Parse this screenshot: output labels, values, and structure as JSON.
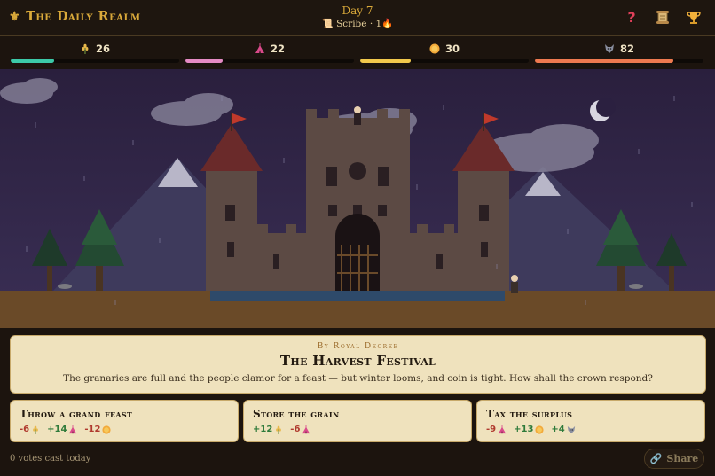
{
  "header": {
    "brand": "The Daily Realm",
    "brand_icon": "fleur-de-lis-icon",
    "day": "Day 7",
    "rank": "Scribe",
    "streak": "1",
    "icons": [
      "help-icon",
      "scroll-icon",
      "trophy-icon"
    ]
  },
  "stats": [
    {
      "name": "food",
      "icon": "wheat-icon",
      "value": "26",
      "fraction": 0.26,
      "color": "#3cc9a8"
    },
    {
      "name": "people",
      "icon": "tent-icon",
      "value": "22",
      "fraction": 0.22,
      "color": "#e58bc4"
    },
    {
      "name": "gold",
      "icon": "coin-icon",
      "value": "30",
      "fraction": 0.3,
      "color": "#f2c94c"
    },
    {
      "name": "military",
      "icon": "wolf-icon",
      "value": "82",
      "fraction": 0.82,
      "color": "#ef7a50"
    }
  ],
  "decree": {
    "kicker": "By Royal Decree",
    "title": "The Harvest Festival",
    "description": "The granaries are full and the people clamor for a feast — but winter looms, and coin is tight. How shall the crown respond?"
  },
  "choices": [
    {
      "title": "Throw a grand feast",
      "effects": [
        {
          "text": "-6",
          "icon": "wheat-icon",
          "sign": "neg"
        },
        {
          "text": "+14",
          "icon": "tent-icon",
          "sign": "pos"
        },
        {
          "text": "-12",
          "icon": "coin-icon",
          "sign": "neg"
        }
      ]
    },
    {
      "title": "Store the grain",
      "effects": [
        {
          "text": "+12",
          "icon": "wheat-icon",
          "sign": "pos"
        },
        {
          "text": "-6",
          "icon": "tent-icon",
          "sign": "neg"
        }
      ]
    },
    {
      "title": "Tax the surplus",
      "effects": [
        {
          "text": "-9",
          "icon": "tent-icon",
          "sign": "neg"
        },
        {
          "text": "+13",
          "icon": "coin-icon",
          "sign": "pos"
        },
        {
          "text": "+4",
          "icon": "wolf-icon",
          "sign": "pos"
        }
      ]
    }
  ],
  "footer": {
    "votes": "0 votes cast today",
    "share_label": "Share"
  }
}
